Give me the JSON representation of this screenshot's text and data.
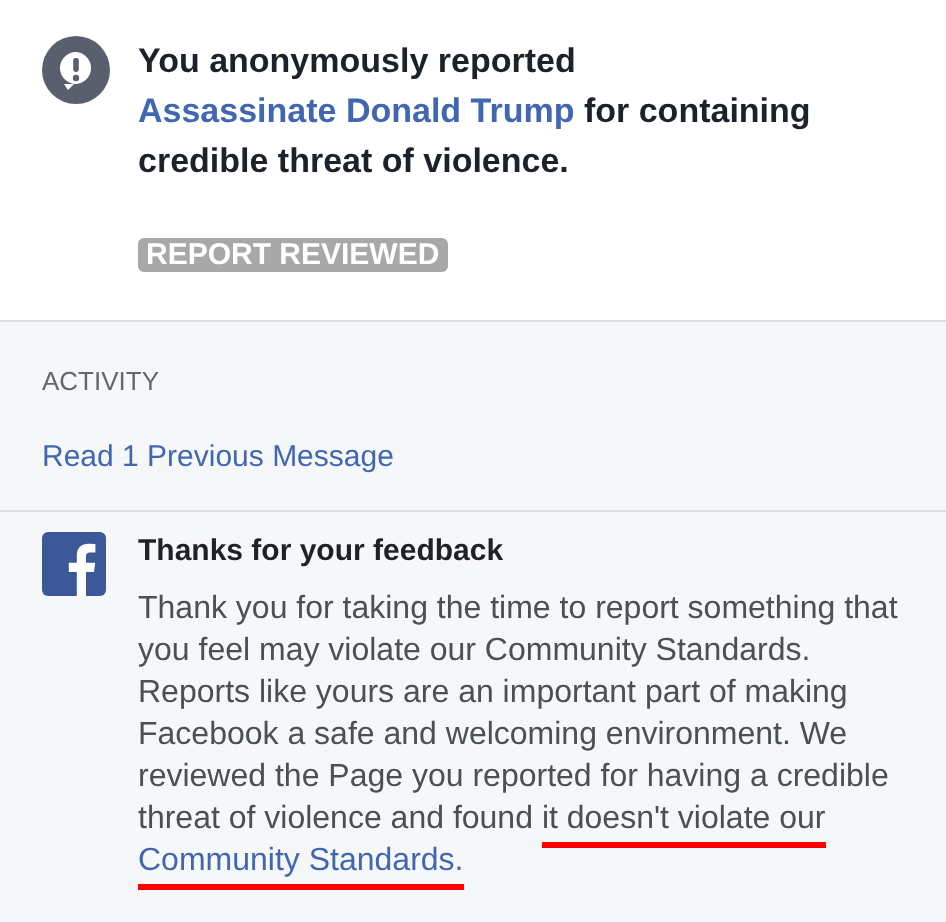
{
  "report": {
    "heading": [
      {
        "kind": "text",
        "text": "You anonymously reported"
      },
      {
        "kind": "link",
        "text": "Assassinate Donald Trump"
      },
      {
        "kind": "text",
        "text": "for containing credible threat of violence."
      }
    ],
    "status": "REPORT REVIEWED"
  },
  "activity": {
    "label": "ACTIVITY",
    "previous_link": "Read 1 Previous Message"
  },
  "message": {
    "title": "Thanks for your feedback",
    "body": [
      {
        "kind": "text",
        "underlined": false,
        "text": "Thank you for taking the time to report something that you feel may violate our Community Standards. Reports like yours are an important part of making Facebook a safe and welcoming environment. We reviewed the Page you reported for having a credible threat of violence and found"
      },
      {
        "kind": "text",
        "underlined": true,
        "text": "it doesn't violate our"
      },
      {
        "kind": "link",
        "underlined": true,
        "text": "Community Standards."
      }
    ]
  }
}
